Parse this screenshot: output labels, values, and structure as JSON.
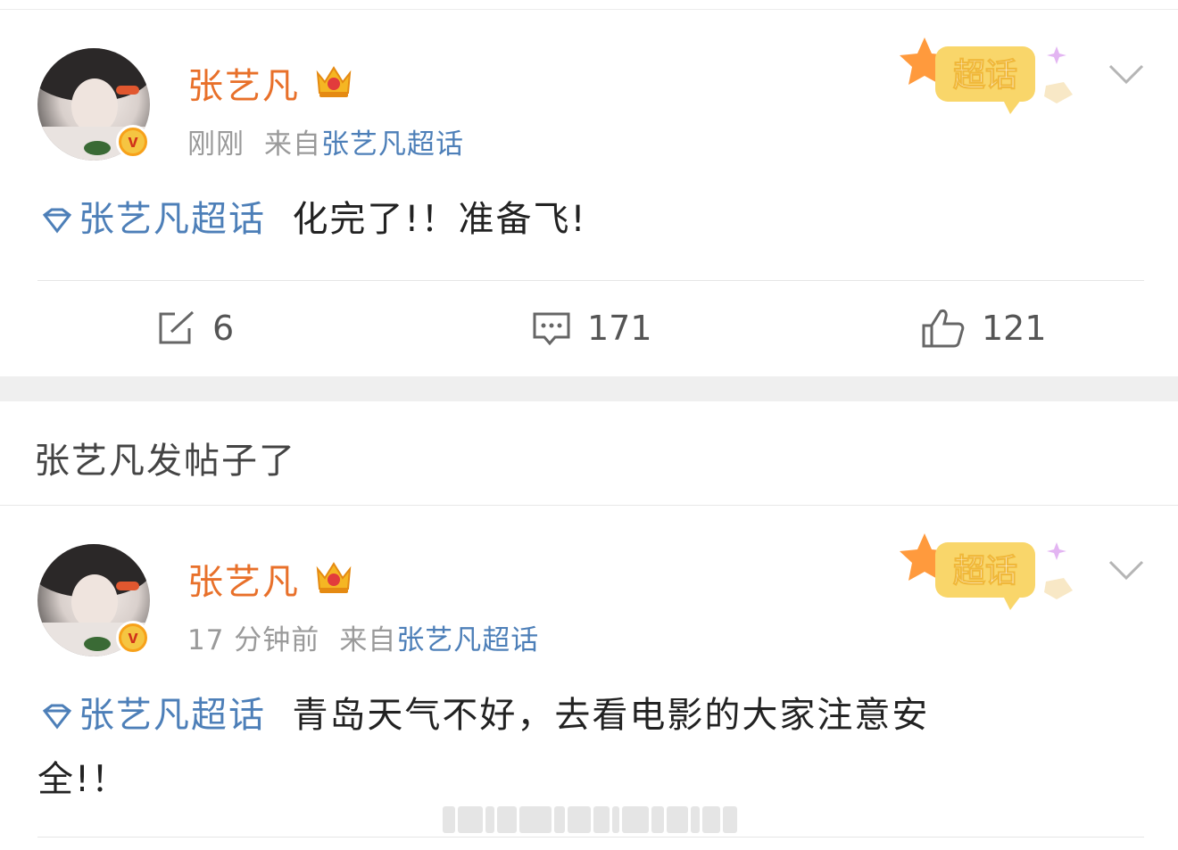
{
  "posts": [
    {
      "username": "张艺凡",
      "time": "刚刚",
      "from_prefix": "来自",
      "from_source": "张艺凡超话",
      "super_badge_label": "超话",
      "topic": "张艺凡超话",
      "text": "化完了!！准备飞!",
      "actions": {
        "repost": "6",
        "comment": "171",
        "like": "121"
      }
    },
    {
      "username": "张艺凡",
      "time": "17 分钟前",
      "from_prefix": "来自",
      "from_source": "张艺凡超话",
      "super_badge_label": "超话",
      "topic": "张艺凡超话",
      "text_line1": "青岛天气不好，去看电影的大家注意安",
      "text_line2": "全!！"
    }
  ],
  "section_title": "张艺凡发帖子了",
  "icons": {
    "verified": "verified-badge-icon",
    "crown": "crown-icon",
    "topic": "diamond-topic-icon",
    "more": "chevron-down-icon",
    "repost": "repost-icon",
    "comment": "comment-icon",
    "like": "thumbs-up-icon"
  },
  "colors": {
    "username": "#e8702a",
    "link": "#4d7fb8",
    "meta": "#9a9a9a",
    "badge_yellow": "#f7c948"
  }
}
